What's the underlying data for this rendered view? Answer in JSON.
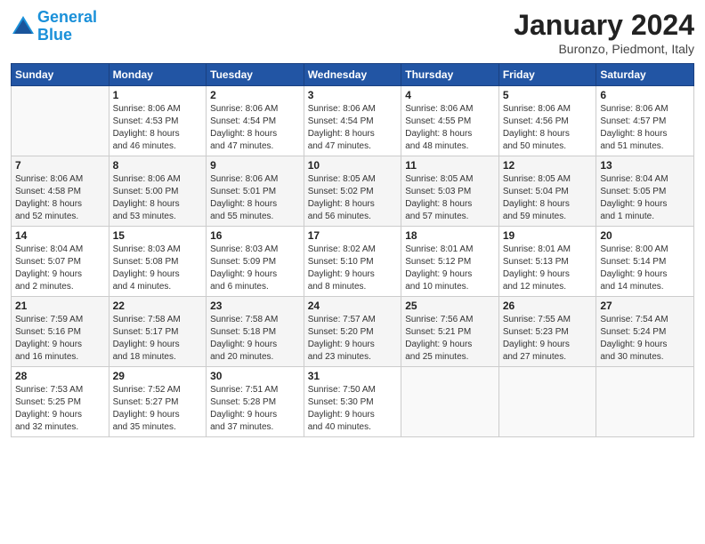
{
  "header": {
    "logo_line1": "General",
    "logo_line2": "Blue",
    "month_title": "January 2024",
    "location": "Buronzo, Piedmont, Italy"
  },
  "weekdays": [
    "Sunday",
    "Monday",
    "Tuesday",
    "Wednesday",
    "Thursday",
    "Friday",
    "Saturday"
  ],
  "weeks": [
    [
      {
        "day": "",
        "info": ""
      },
      {
        "day": "1",
        "info": "Sunrise: 8:06 AM\nSunset: 4:53 PM\nDaylight: 8 hours\nand 46 minutes."
      },
      {
        "day": "2",
        "info": "Sunrise: 8:06 AM\nSunset: 4:54 PM\nDaylight: 8 hours\nand 47 minutes."
      },
      {
        "day": "3",
        "info": "Sunrise: 8:06 AM\nSunset: 4:54 PM\nDaylight: 8 hours\nand 47 minutes."
      },
      {
        "day": "4",
        "info": "Sunrise: 8:06 AM\nSunset: 4:55 PM\nDaylight: 8 hours\nand 48 minutes."
      },
      {
        "day": "5",
        "info": "Sunrise: 8:06 AM\nSunset: 4:56 PM\nDaylight: 8 hours\nand 50 minutes."
      },
      {
        "day": "6",
        "info": "Sunrise: 8:06 AM\nSunset: 4:57 PM\nDaylight: 8 hours\nand 51 minutes."
      }
    ],
    [
      {
        "day": "7",
        "info": "Sunrise: 8:06 AM\nSunset: 4:58 PM\nDaylight: 8 hours\nand 52 minutes."
      },
      {
        "day": "8",
        "info": "Sunrise: 8:06 AM\nSunset: 5:00 PM\nDaylight: 8 hours\nand 53 minutes."
      },
      {
        "day": "9",
        "info": "Sunrise: 8:06 AM\nSunset: 5:01 PM\nDaylight: 8 hours\nand 55 minutes."
      },
      {
        "day": "10",
        "info": "Sunrise: 8:05 AM\nSunset: 5:02 PM\nDaylight: 8 hours\nand 56 minutes."
      },
      {
        "day": "11",
        "info": "Sunrise: 8:05 AM\nSunset: 5:03 PM\nDaylight: 8 hours\nand 57 minutes."
      },
      {
        "day": "12",
        "info": "Sunrise: 8:05 AM\nSunset: 5:04 PM\nDaylight: 8 hours\nand 59 minutes."
      },
      {
        "day": "13",
        "info": "Sunrise: 8:04 AM\nSunset: 5:05 PM\nDaylight: 9 hours\nand 1 minute."
      }
    ],
    [
      {
        "day": "14",
        "info": "Sunrise: 8:04 AM\nSunset: 5:07 PM\nDaylight: 9 hours\nand 2 minutes."
      },
      {
        "day": "15",
        "info": "Sunrise: 8:03 AM\nSunset: 5:08 PM\nDaylight: 9 hours\nand 4 minutes."
      },
      {
        "day": "16",
        "info": "Sunrise: 8:03 AM\nSunset: 5:09 PM\nDaylight: 9 hours\nand 6 minutes."
      },
      {
        "day": "17",
        "info": "Sunrise: 8:02 AM\nSunset: 5:10 PM\nDaylight: 9 hours\nand 8 minutes."
      },
      {
        "day": "18",
        "info": "Sunrise: 8:01 AM\nSunset: 5:12 PM\nDaylight: 9 hours\nand 10 minutes."
      },
      {
        "day": "19",
        "info": "Sunrise: 8:01 AM\nSunset: 5:13 PM\nDaylight: 9 hours\nand 12 minutes."
      },
      {
        "day": "20",
        "info": "Sunrise: 8:00 AM\nSunset: 5:14 PM\nDaylight: 9 hours\nand 14 minutes."
      }
    ],
    [
      {
        "day": "21",
        "info": "Sunrise: 7:59 AM\nSunset: 5:16 PM\nDaylight: 9 hours\nand 16 minutes."
      },
      {
        "day": "22",
        "info": "Sunrise: 7:58 AM\nSunset: 5:17 PM\nDaylight: 9 hours\nand 18 minutes."
      },
      {
        "day": "23",
        "info": "Sunrise: 7:58 AM\nSunset: 5:18 PM\nDaylight: 9 hours\nand 20 minutes."
      },
      {
        "day": "24",
        "info": "Sunrise: 7:57 AM\nSunset: 5:20 PM\nDaylight: 9 hours\nand 23 minutes."
      },
      {
        "day": "25",
        "info": "Sunrise: 7:56 AM\nSunset: 5:21 PM\nDaylight: 9 hours\nand 25 minutes."
      },
      {
        "day": "26",
        "info": "Sunrise: 7:55 AM\nSunset: 5:23 PM\nDaylight: 9 hours\nand 27 minutes."
      },
      {
        "day": "27",
        "info": "Sunrise: 7:54 AM\nSunset: 5:24 PM\nDaylight: 9 hours\nand 30 minutes."
      }
    ],
    [
      {
        "day": "28",
        "info": "Sunrise: 7:53 AM\nSunset: 5:25 PM\nDaylight: 9 hours\nand 32 minutes."
      },
      {
        "day": "29",
        "info": "Sunrise: 7:52 AM\nSunset: 5:27 PM\nDaylight: 9 hours\nand 35 minutes."
      },
      {
        "day": "30",
        "info": "Sunrise: 7:51 AM\nSunset: 5:28 PM\nDaylight: 9 hours\nand 37 minutes."
      },
      {
        "day": "31",
        "info": "Sunrise: 7:50 AM\nSunset: 5:30 PM\nDaylight: 9 hours\nand 40 minutes."
      },
      {
        "day": "",
        "info": ""
      },
      {
        "day": "",
        "info": ""
      },
      {
        "day": "",
        "info": ""
      }
    ]
  ]
}
